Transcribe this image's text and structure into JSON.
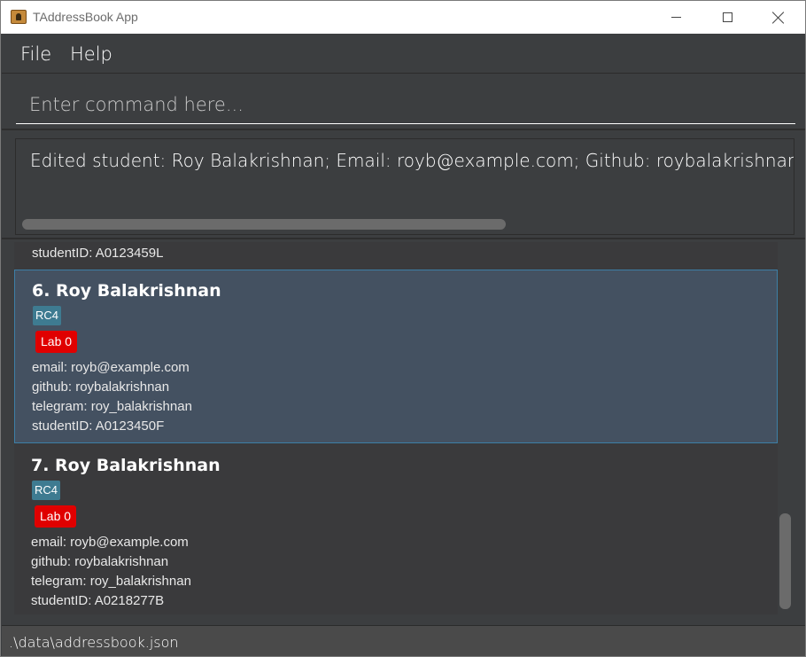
{
  "window": {
    "title": "TAddressBook App"
  },
  "menu": {
    "file": "File",
    "help": "Help"
  },
  "command": {
    "placeholder": "Enter command here...",
    "value": ""
  },
  "result": {
    "text": "Edited student: Roy Balakrishnan; Email: royb@example.com; Github: roybalakrishnan; Telegram"
  },
  "list": {
    "partial_row": "studentID: A0123459L",
    "cards": [
      {
        "title": "6.  Roy Balakrishnan",
        "tag": "RC4",
        "lab": "Lab 0",
        "email": "email: royb@example.com",
        "github": "github: roybalakrishnan",
        "telegram": "telegram: roy_balakrishnan",
        "student_id": "studentID: A0123450F",
        "selected": true
      },
      {
        "title": "7.  Roy Balakrishnan",
        "tag": "RC4",
        "lab": "Lab 0",
        "email": "email: royb@example.com",
        "github": "github: roybalakrishnan",
        "telegram": "telegram: roy_balakrishnan",
        "student_id": "studentID: A0218277B",
        "selected": false
      }
    ]
  },
  "status": {
    "file_path": ".\\data\\addressbook.json"
  },
  "colors": {
    "background": "#3c3e40",
    "selected_card": "#445161",
    "tag_rc": "#3e7b91",
    "tag_lab": "#e00000"
  }
}
